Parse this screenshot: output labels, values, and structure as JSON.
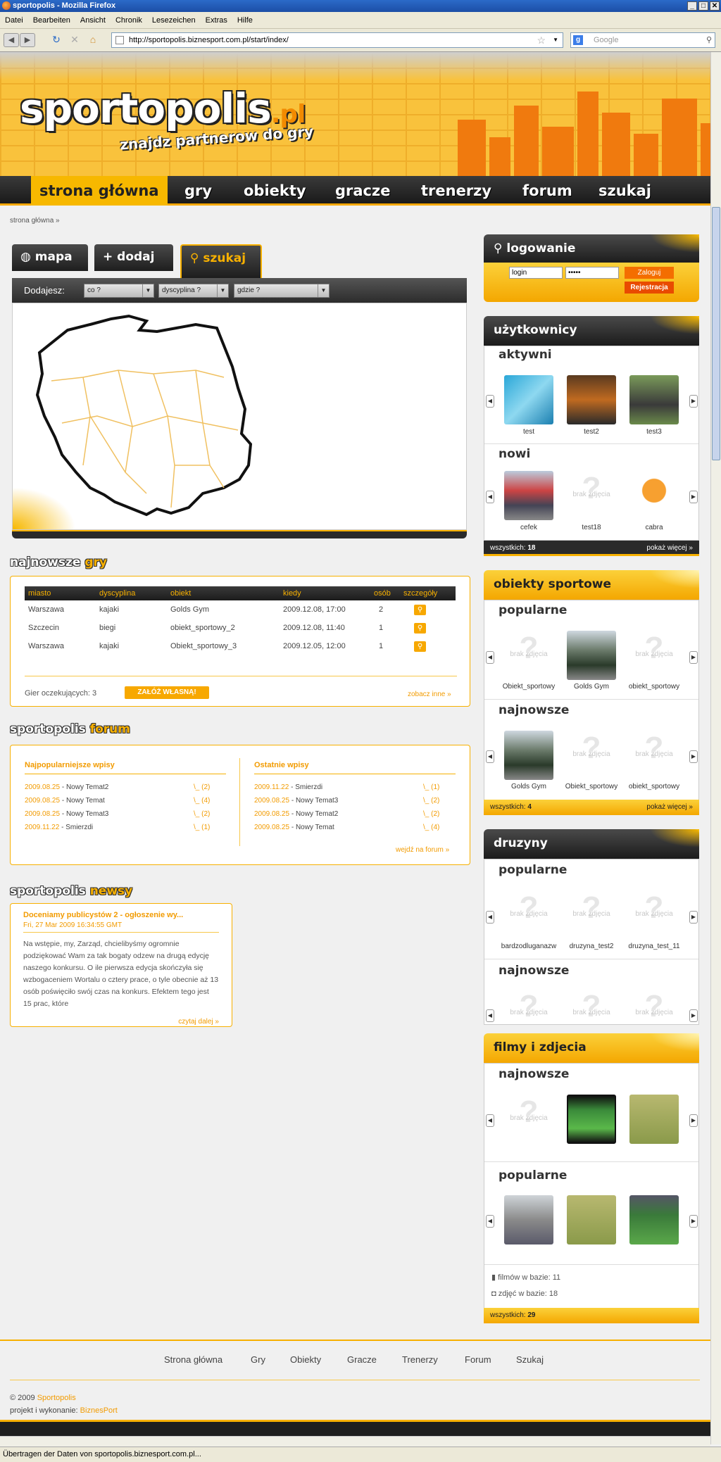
{
  "window": {
    "title": "sportopolis - Mozilla Firefox"
  },
  "menu": [
    "Datei",
    "Bearbeiten",
    "Ansicht",
    "Chronik",
    "Lesezeichen",
    "Extras",
    "Hilfe"
  ],
  "browser": {
    "url": "http://sportopolis.biznesport.com.pl/start/index/",
    "search_placeholder": "Google",
    "status": "Übertragen der Daten von sportopolis.biznesport.com.pl..."
  },
  "site": {
    "logo": "sportopolis",
    "logo_tld": ".pl",
    "slogan": "znajdz partnerow do gry"
  },
  "nav": [
    "strona główna",
    "gry",
    "obiekty",
    "gracze",
    "trenerzy",
    "forum",
    "szukaj"
  ],
  "breadcrumb": "strona główna »",
  "tabs": {
    "mapa": "mapa",
    "dodaj": "+ dodaj",
    "szukaj": "szukaj"
  },
  "mapbar": {
    "label": "Dodajesz:",
    "co": "co ?",
    "dyscyplina": "dyscyplina ?",
    "gdzie": "gdzie ?"
  },
  "games": {
    "head1": "najnowsze",
    "head2": "gry",
    "columns": [
      "miasto",
      "dyscyplina",
      "obiekt",
      "kiedy",
      "osób",
      "szczegóły"
    ],
    "rows": [
      [
        "Warszawa",
        "kajaki",
        "Golds Gym",
        "2009.12.08, 17:00",
        "2"
      ],
      [
        "Szczecin",
        "biegi",
        "obiekt_sportowy_2",
        "2009.12.08, 11:40",
        "1"
      ],
      [
        "Warszawa",
        "kajaki",
        "Obiekt_sportowy_3",
        "2009.12.05, 12:00",
        "1"
      ]
    ],
    "waiting": "Gier oczekujących: 3",
    "own": "ZAŁÓŻ WŁASNĄ!",
    "more": "zobacz inne »"
  },
  "forum": {
    "head1": "sportopolis",
    "head2": "forum",
    "popular_title": "Najpopularniejsze wpisy",
    "latest_title": "Ostatnie wpisy",
    "popular": [
      {
        "date": "2009.08.25",
        "title": " - Nowy Temat2",
        "count": "\\_ (2)"
      },
      {
        "date": "2009.08.25",
        "title": " - Nowy Temat",
        "count": "\\_ (4)"
      },
      {
        "date": "2009.08.25",
        "title": " - Nowy Temat3",
        "count": "\\_ (2)"
      },
      {
        "date": "2009.11.22",
        "title": " - Smierzdi",
        "count": "\\_ (1)"
      }
    ],
    "latest": [
      {
        "date": "2009.11.22",
        "title": " - Smierzdi",
        "count": "\\_ (1)"
      },
      {
        "date": "2009.08.25",
        "title": " - Nowy Temat3",
        "count": "\\_ (2)"
      },
      {
        "date": "2009.08.25",
        "title": " - Nowy Temat2",
        "count": "\\_ (2)"
      },
      {
        "date": "2009.08.25",
        "title": " - Nowy Temat",
        "count": "\\_ (4)"
      }
    ],
    "more": "wejdź na forum »"
  },
  "news": {
    "head1": "sportopolis",
    "head2": "newsy",
    "title": "Doceniamy publicystów 2 - ogłoszenie wy...",
    "date": "Fri, 27 Mar 2009 16:34:55 GMT",
    "body": "Na wstępie, my, Zarząd, chcielibyśmy ogromnie podziękować Wam za tak bogaty odzew na drugą edycję naszego konkursu. O ile pierwsza edycja skończyła się wzbogaceniem Wortalu o cztery prace, o tyle obecnie aż 13 osób poświęciło swój czas na konkurs. Efektem tego jest 15 prac, które",
    "more": "czytaj dalej »"
  },
  "login": {
    "title": "logowanie",
    "user": "login",
    "pass": "•••••",
    "submit": "Zaloguj",
    "register": "Rejestracja"
  },
  "users": {
    "title": "użytkownicy",
    "active_title": "aktywni",
    "new_title": "nowi",
    "active": [
      "test",
      "test2",
      "test3"
    ],
    "new": [
      "cefek",
      "test18",
      "cabra"
    ],
    "count_label": "wszystkich:",
    "count": "18",
    "more": "pokaż więcej »"
  },
  "objects": {
    "title": "obiekty sportowe",
    "popular_title": "popularne",
    "latest_title": "najnowsze",
    "popular": [
      "Obiekt_sportowy",
      "Golds Gym",
      "obiekt_sportowy"
    ],
    "latest": [
      "Golds Gym",
      "Obiekt_sportowy",
      "obiekt_sportowy"
    ],
    "count_label": "wszystkich:",
    "count": "4",
    "more": "pokaż więcej »"
  },
  "teams": {
    "title": "druzyny",
    "popular_title": "popularne",
    "latest_title": "najnowsze",
    "popular": [
      "bardzodluganazw",
      "druzyna_test2",
      "druzyna_test_11"
    ]
  },
  "media": {
    "title": "filmy i zdjecia",
    "latest_title": "najnowsze",
    "popular_title": "popularne",
    "films_label": "filmów w bazie:",
    "films": "11",
    "photos_label": "zdjęć w bazie:",
    "photos": "18",
    "count_label": "wszystkich:",
    "count": "29"
  },
  "noimage": "brak zdjęcia",
  "footer": {
    "links": [
      "Strona główna",
      "Gry",
      "Obiekty",
      "Gracze",
      "Trenerzy",
      "Forum",
      "Szukaj"
    ],
    "copy": "© 2009",
    "brand": "Sportopolis",
    "made": "projekt i wykonanie:",
    "maker": "BiznesPort"
  },
  "colors": {
    "accent": "#f7b000",
    "dark": "#1f1f1f",
    "link": "#f29b00"
  }
}
